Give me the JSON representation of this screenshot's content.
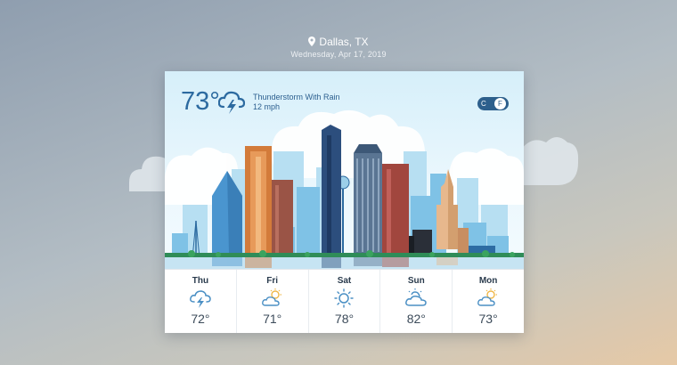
{
  "location": {
    "city": "Dallas, TX",
    "date": "Wednesday, Apr 17, 2019"
  },
  "current": {
    "temperature": "73°",
    "condition": "Thunderstorm With Rain",
    "wind": "12 mph",
    "icon": "thunderstorm-icon"
  },
  "units": {
    "celsius": "C",
    "fahrenheit": "F",
    "selected": "F"
  },
  "forecast": [
    {
      "day": "Thu",
      "temp": "72°",
      "icon": "thunderstorm-icon"
    },
    {
      "day": "Fri",
      "temp": "71°",
      "icon": "partly-sunny-icon"
    },
    {
      "day": "Sat",
      "temp": "78°",
      "icon": "sunny-icon"
    },
    {
      "day": "Sun",
      "temp": "82°",
      "icon": "partly-cloudy-icon"
    },
    {
      "day": "Mon",
      "temp": "73°",
      "icon": "partly-sunny-icon"
    }
  ],
  "colors": {
    "accent": "#2c6aa0",
    "toggle": "#2d5f8c",
    "icon": "#4a8fc4",
    "sun": "#f0b848"
  }
}
